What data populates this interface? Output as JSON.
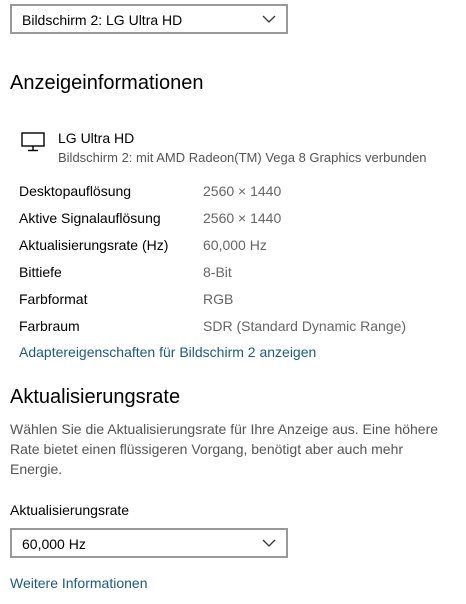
{
  "display_selector": {
    "selected": "Bildschirm 2: LG Ultra HD",
    "icon": "chevron-down-icon"
  },
  "display_info": {
    "heading": "Anzeigeinformationen",
    "monitor_icon": "monitor-icon",
    "monitor_name": "LG Ultra HD",
    "monitor_description": "Bildschirm 2: mit AMD Radeon(TM) Vega 8 Graphics verbunden",
    "rows": [
      {
        "label": "Desktopauflösung",
        "value": "2560 × 1440"
      },
      {
        "label": "Aktive Signalauflösung",
        "value": "2560 × 1440"
      },
      {
        "label": "Aktualisierungsrate (Hz)",
        "value": "60,000 Hz"
      },
      {
        "label": "Bittiefe",
        "value": "8-Bit"
      },
      {
        "label": "Farbformat",
        "value": "RGB"
      },
      {
        "label": "Farbraum",
        "value": "SDR (Standard Dynamic Range)"
      }
    ],
    "adapter_link": "Adaptereigenschaften für Bildschirm 2 anzeigen"
  },
  "refresh_rate": {
    "heading": "Aktualisierungsrate",
    "description": "Wählen Sie die Aktualisierungsrate für Ihre Anzeige aus. Eine höhere Rate bietet einen flüssigeren Vorgang, benötigt aber auch mehr Energie.",
    "field_label": "Aktualisierungsrate",
    "selected": "60,000 Hz",
    "more_info_link": "Weitere Informationen"
  },
  "colors": {
    "link": "#1a5a8a",
    "secondary_text": "#666666",
    "dropdown_border": "#999999"
  }
}
